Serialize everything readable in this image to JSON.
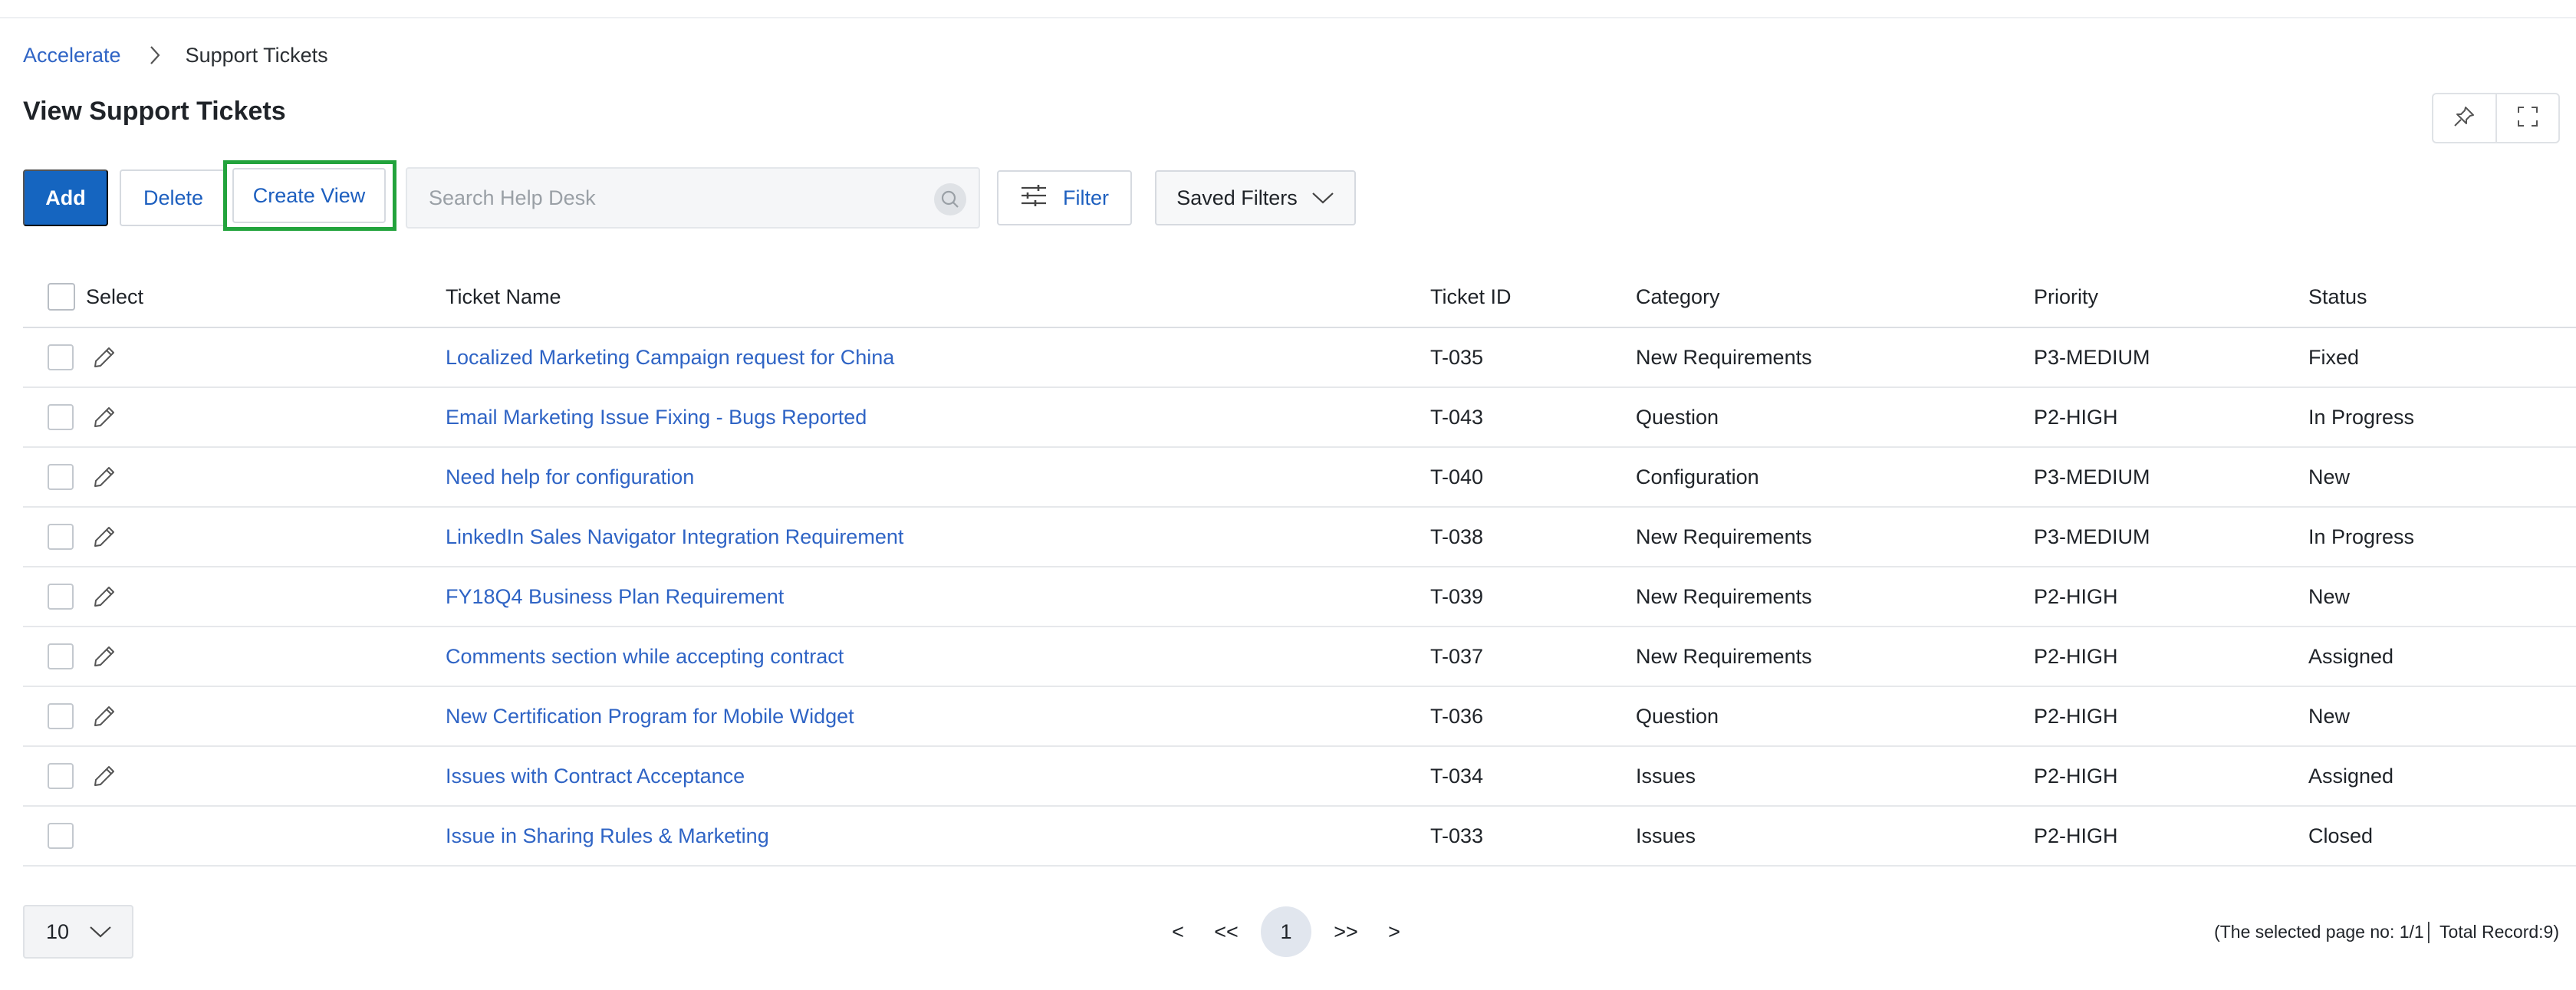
{
  "breadcrumb": {
    "parent": "Accelerate",
    "current": "Support Tickets"
  },
  "page": {
    "title": "View Support Tickets"
  },
  "toolbar": {
    "add_label": "Add",
    "delete_label": "Delete",
    "create_view_label": "Create View",
    "search_placeholder": "Search Help Desk",
    "filter_label": "Filter",
    "saved_filters_label": "Saved Filters"
  },
  "table": {
    "columns": {
      "select": "Select",
      "name": "Ticket Name",
      "id": "Ticket ID",
      "category": "Category",
      "priority": "Priority",
      "status": "Status"
    },
    "rows": [
      {
        "name": "Localized Marketing Campaign request for China",
        "id": "T-035",
        "category": "New Requirements",
        "priority": "P3-MEDIUM",
        "status": "Fixed",
        "editable": true
      },
      {
        "name": "Email Marketing Issue Fixing - Bugs Reported",
        "id": "T-043",
        "category": "Question",
        "priority": "P2-HIGH",
        "status": "In Progress",
        "editable": true
      },
      {
        "name": "Need help for configuration",
        "id": "T-040",
        "category": "Configuration",
        "priority": "P3-MEDIUM",
        "status": "New",
        "editable": true
      },
      {
        "name": "LinkedIn Sales Navigator Integration Requirement",
        "id": "T-038",
        "category": "New Requirements",
        "priority": "P3-MEDIUM",
        "status": "In Progress",
        "editable": true
      },
      {
        "name": "FY18Q4 Business Plan Requirement",
        "id": "T-039",
        "category": "New Requirements",
        "priority": "P2-HIGH",
        "status": "New",
        "editable": true
      },
      {
        "name": "Comments section while accepting contract",
        "id": "T-037",
        "category": "New Requirements",
        "priority": "P2-HIGH",
        "status": "Assigned",
        "editable": true
      },
      {
        "name": "New Certification Program for Mobile Widget",
        "id": "T-036",
        "category": "Question",
        "priority": "P2-HIGH",
        "status": "New",
        "editable": true
      },
      {
        "name": "Issues with Contract Acceptance",
        "id": "T-034",
        "category": "Issues",
        "priority": "P2-HIGH",
        "status": "Assigned",
        "editable": true
      },
      {
        "name": "Issue in Sharing Rules & Marketing",
        "id": "T-033",
        "category": "Issues",
        "priority": "P2-HIGH",
        "status": "Closed",
        "editable": false
      }
    ]
  },
  "footer": {
    "page_size": "10",
    "pager": {
      "prev": "<",
      "first": "<<",
      "current": "1",
      "last": ">>",
      "next": ">"
    },
    "info": "(The selected page no: 1/1│ Total Record:9)"
  },
  "colors": {
    "primary": "#1565c0",
    "link": "#2f64c5",
    "highlight": "#22a33c"
  },
  "icons": [
    "chevron-right-icon",
    "pin-icon",
    "fullscreen-icon",
    "search-icon",
    "filter-sliders-icon",
    "chevron-down-icon",
    "pencil-icon"
  ]
}
